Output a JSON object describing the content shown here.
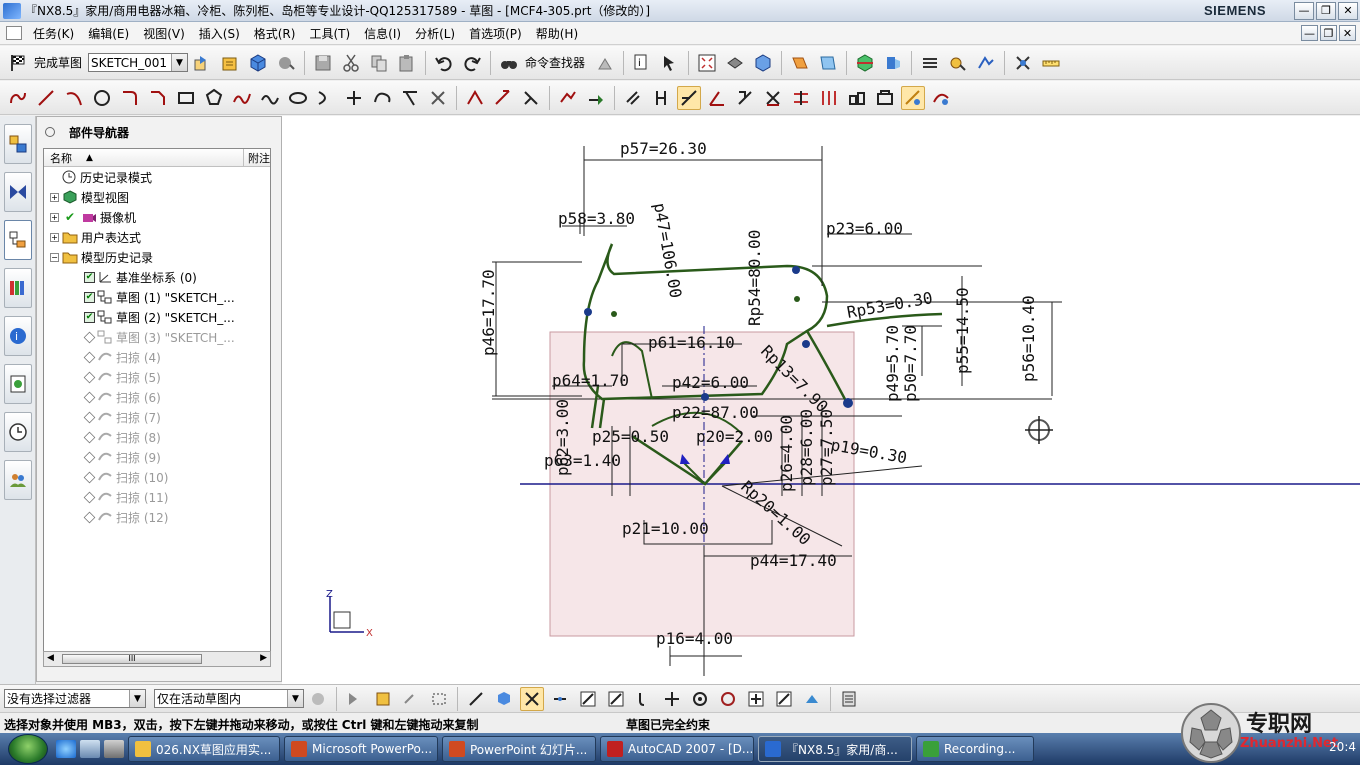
{
  "window": {
    "title": "『NX8.5』家用/商用电器冰箱、冷柜、陈列柜、岛柜等专业设计-QQ125317589 - 草图 - [MCF4-305.prt（修改的）]",
    "brand": "SIEMENS",
    "controls": [
      "—",
      "❐",
      "✕"
    ],
    "mdi_controls": [
      "—",
      "❐",
      "✕"
    ]
  },
  "menu": {
    "items": [
      "任务(K)",
      "编辑(E)",
      "视图(V)",
      "插入(S)",
      "格式(R)",
      "工具(T)",
      "信息(I)",
      "分析(L)",
      "首选项(P)",
      "帮助(H)"
    ]
  },
  "toolbar1": {
    "finish_sketch": "完成草图",
    "sketch_name": "SKETCH_001",
    "command_finder": "命令查找器"
  },
  "navigator": {
    "title": "部件导航器",
    "col_name": "名称",
    "col_attach": "附注",
    "scroll_glyph": "III",
    "nodes": [
      {
        "label": "历史记录模式"
      },
      {
        "label": "模型视图"
      },
      {
        "label": "摄像机"
      },
      {
        "label": "用户表达式"
      },
      {
        "label": "模型历史记录"
      },
      {
        "label": "基准坐标系 (0)"
      },
      {
        "label": "草图 (1) \"SKETCH_..."
      },
      {
        "label": "草图 (2) \"SKETCH_..."
      },
      {
        "label": "草图 (3) \"SKETCH_..."
      },
      {
        "label": "扫掠 (4)"
      },
      {
        "label": "扫掠 (5)"
      },
      {
        "label": "扫掠 (6)"
      },
      {
        "label": "扫掠 (7)"
      },
      {
        "label": "扫掠 (8)"
      },
      {
        "label": "扫掠 (9)"
      },
      {
        "label": "扫掠 (10)"
      },
      {
        "label": "扫掠 (11)"
      },
      {
        "label": "扫掠 (12)"
      }
    ]
  },
  "dimensions": {
    "p57": "p57=26.30",
    "p58": "p58=3.80",
    "p47": "p47=106.00",
    "Rp54": "Rp54=80.00",
    "p23": "p23=6.00",
    "p46": "p46=17.70",
    "Rp53": "Rp53=0.30",
    "p55": "p55=14.50",
    "p56": "p56=10.40",
    "p61": "p61=16.10",
    "p49": "p49=5.70",
    "p50": "p50=7.70",
    "Rp13": "Rp13=7.90",
    "p64": "p64=1.70",
    "p42": "p42=6.00",
    "p22": "p22=87.00",
    "p62": "p62=3.00",
    "p25": "p25=0.50",
    "p20": "p20=2.00",
    "p19": "p19=0.30",
    "p63": "p63=1.40",
    "p26": "p26=4.00",
    "p28": "p28=6.00",
    "p27": "p27=7.50",
    "Rp20": "Rp20=1.00",
    "p21": "p21=10.00",
    "p44": "p44=17.40",
    "p16": "p16=4.00"
  },
  "axes": {
    "z": "Z",
    "x": "X"
  },
  "filterbar": {
    "filter": "没有选择过滤器",
    "scope": "仅在活动草图内"
  },
  "status": {
    "prompt": "选择对象并使用 MB3，双击，按下左键并拖动来移动，或按住 Ctrl 键和左键拖动来复制",
    "message": "草图已完全约束"
  },
  "taskbar": {
    "tasks": [
      "026.NX草图应用实...",
      "Microsoft PowerPo...",
      "PowerPoint 幻灯片...",
      "AutoCAD 2007 - [D...",
      "『NX8.5』家用/商...",
      "Recording..."
    ],
    "clock": "20:4"
  },
  "watermark": {
    "text": "专职网",
    "url": "Zhuanzhi.Net"
  },
  "colors": {
    "curve": "#2a5a1a",
    "dimension": "#111111",
    "datum": "#1a1a8a",
    "sheet": "#f6e6e8"
  }
}
